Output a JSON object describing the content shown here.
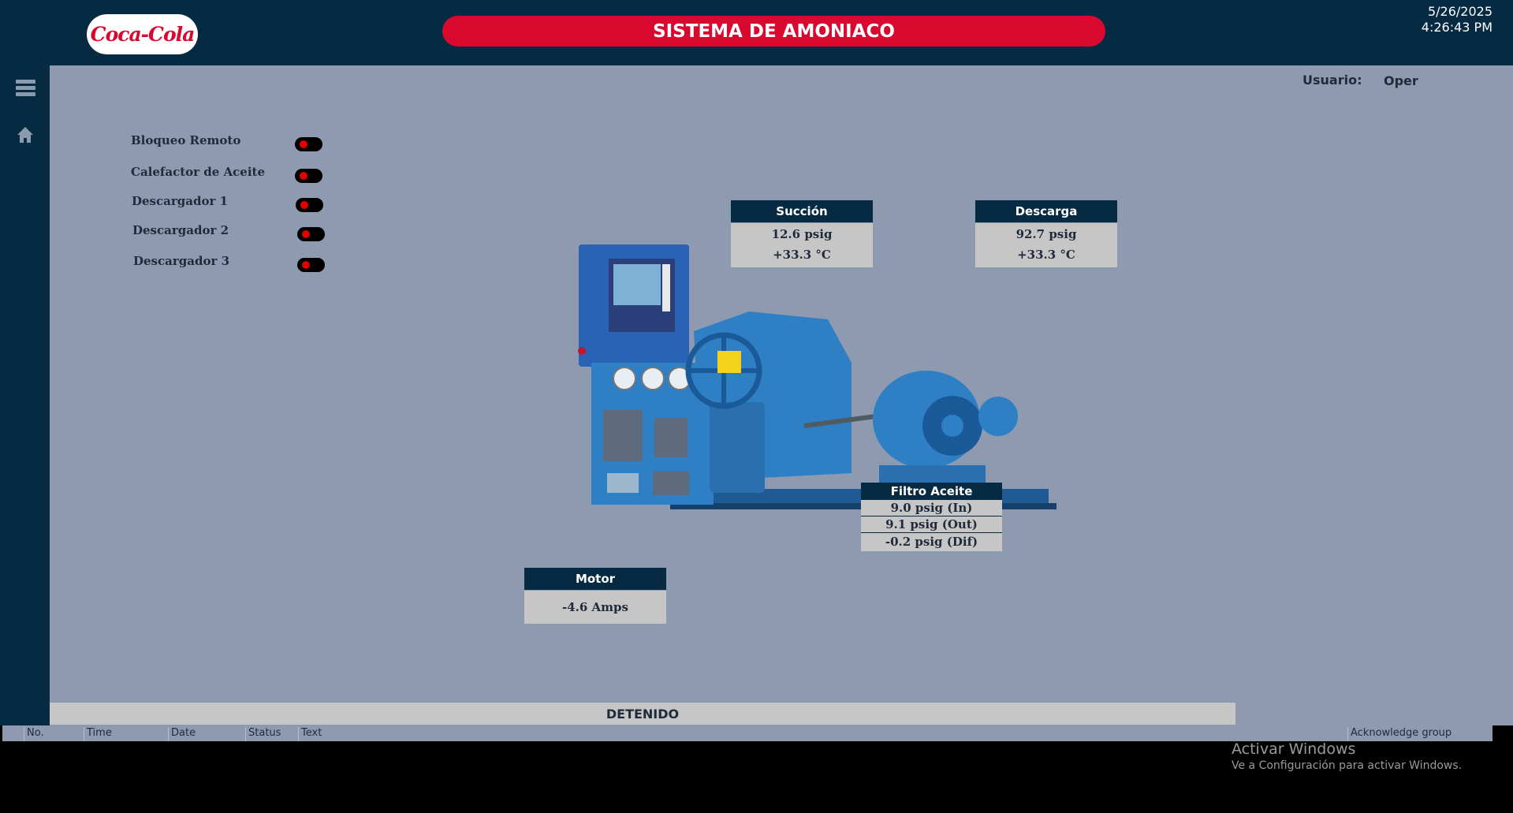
{
  "header": {
    "logo_text": "Coca-Cola",
    "title": "SISTEMA DE AMONIACO",
    "date": "5/26/2025",
    "time": "4:26:43 PM"
  },
  "user": {
    "label": "Usuario:",
    "value": "Oper"
  },
  "indicators": [
    {
      "label": "Bloqueo Remoto",
      "state": "red"
    },
    {
      "label": "Calefactor de Aceite",
      "state": "red"
    },
    {
      "label": "Descargador 1",
      "state": "red"
    },
    {
      "label": "Descargador 2",
      "state": "red"
    },
    {
      "label": "Descargador 3",
      "state": "red"
    }
  ],
  "succion": {
    "title": "Succión",
    "pressure": "12.6 psig",
    "temp": "+33.3 °C"
  },
  "descarga": {
    "title": "Descarga",
    "pressure": "92.7 psig",
    "temp": "+33.3 °C"
  },
  "filtro": {
    "title": "Filtro Aceite",
    "in": "9.0 psig (In)",
    "out": "9.1 psig (Out)",
    "dif": "-0.2 psig (Dif)"
  },
  "motor": {
    "title": "Motor",
    "amps": "-4.6 Amps"
  },
  "status": "DETENIDO",
  "alarm_table": {
    "columns": [
      "No.",
      "Time",
      "Date",
      "Status",
      "Text",
      "Acknowledge group"
    ]
  },
  "windows_notice": {
    "line1": "Activar Windows",
    "line2": "Ve a Configuración para activar Windows."
  },
  "colors": {
    "navy": "#052a41",
    "brand_red": "#d9082f",
    "panel_bg": "#8d9ab0",
    "led_off": "#e10000",
    "machine_blue": "#2f7fc4"
  }
}
